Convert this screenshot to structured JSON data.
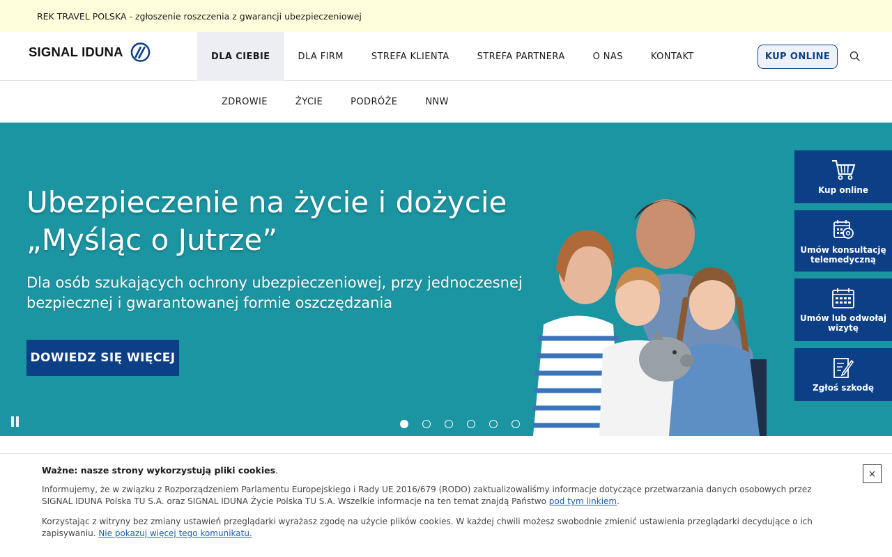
{
  "announcement": {
    "text": "REK TRAVEL POLSKA - zgłoszenie roszczenia z gwarancji ubezpieczeniowej"
  },
  "header": {
    "logo_text": "SIGNAL IDUNA",
    "nav": [
      {
        "label": "DLA CIEBIE"
      },
      {
        "label": "DLA FIRM"
      },
      {
        "label": "STREFA KLIENTA"
      },
      {
        "label": "STREFA PARTNERA"
      },
      {
        "label": "O NAS"
      },
      {
        "label": "KONTAKT"
      }
    ],
    "buy_label": "KUP ONLINE",
    "search_icon": "search-icon"
  },
  "subnav": [
    {
      "label": "ZDROWIE"
    },
    {
      "label": "ŻYCIE"
    },
    {
      "label": "PODRÓŻE"
    },
    {
      "label": "NNW"
    }
  ],
  "hero": {
    "title_line1": "Ubezpieczenie na życie i dożycie",
    "title_line2": "„Myśląc o Jutrze”",
    "subtitle_line1": "Dla osób szukających ochrony ubezpieczeniowej, przy jednoczesnej",
    "subtitle_line2": "bezpiecznej i gwarantowanej formie oszczędzania",
    "cta_label": "DOWIEDZ SIĘ WIĘCEJ",
    "slides_total": 6,
    "active_slide": 1,
    "background_color": "#1c95a2"
  },
  "side_tiles": [
    {
      "label_line1": "Kup online",
      "label_line2": "",
      "icon": "cart-icon"
    },
    {
      "label_line1": "Umów konsultację",
      "label_line2": "telemedyczną",
      "icon": "telemedicine-icon"
    },
    {
      "label_line1": "Umów lub odwołaj",
      "label_line2": "wizytę",
      "icon": "calendar-icon"
    },
    {
      "label_line1": "Zgłoś szkodę",
      "label_line2": "",
      "icon": "claim-form-icon"
    }
  ],
  "cookie": {
    "title_bold": "Ważne: nasze strony wykorzystują pliki cookies",
    "title_end": ".",
    "p1_text": "Informujemy, że w związku z Rozporządzeniem Parlamentu Europejskiego i Rady UE 2016/679 (RODO) zaktualizowaliśmy informacje dotyczące przetwarzania danych osobowych przez SIGNAL IDUNA Polska TU S.A. oraz SIGNAL IDUNA Życie Polska TU S.A. Wszelkie informacje na ten temat znajdą Państwo ",
    "p1_link": "pod tym linkiem",
    "p1_end": ".",
    "p2_text": "Korzystając z witryny bez zmiany ustawień przeglądarki wyrażasz zgodę na użycie plików cookies. W każdej chwili możesz swobodnie zmienić ustawienia przeglądarki decydujące o ich zapisywaniu. ",
    "p2_link": "Nie pokazuj więcej tego komunikatu.",
    "close_label": "×"
  },
  "colors": {
    "brand_blue": "#0d3f86",
    "hero_teal": "#1c95a2",
    "announcement_bg": "#fdfddc"
  }
}
